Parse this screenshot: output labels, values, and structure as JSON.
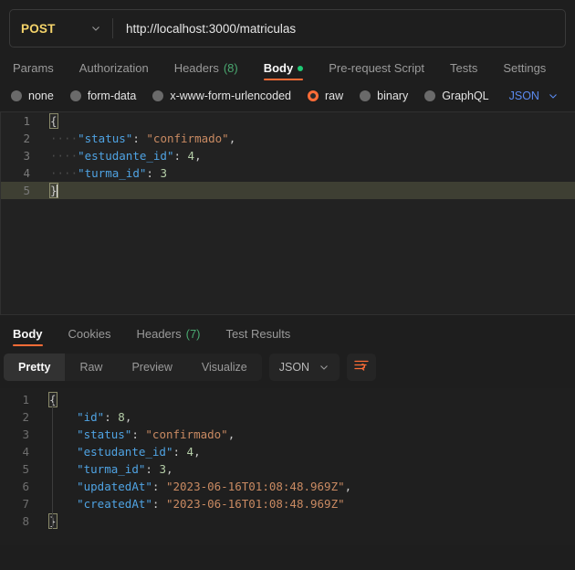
{
  "request": {
    "method": "POST",
    "method_caret_icon": "chevron-down-icon",
    "url": "http://localhost:3000/matriculas",
    "url_placeholder": "Enter request URL",
    "tabs": [
      {
        "label": "Params",
        "active": false
      },
      {
        "label": "Authorization",
        "active": false
      },
      {
        "label": "Headers",
        "count": "(8)",
        "active": false
      },
      {
        "label": "Body",
        "active": true,
        "dot": true
      },
      {
        "label": "Pre-request Script",
        "active": false
      },
      {
        "label": "Tests",
        "active": false
      },
      {
        "label": "Settings",
        "active": false
      }
    ],
    "body_types": [
      {
        "label": "none",
        "selected": false
      },
      {
        "label": "form-data",
        "selected": false
      },
      {
        "label": "x-www-form-urlencoded",
        "selected": false
      },
      {
        "label": "raw",
        "selected": true
      },
      {
        "label": "binary",
        "selected": false
      },
      {
        "label": "GraphQL",
        "selected": false
      }
    ],
    "language": "JSON",
    "language_caret_icon": "chevron-down-icon",
    "editor": {
      "line_numbers": [
        "1",
        "2",
        "3",
        "4",
        "5"
      ],
      "lines": [
        {
          "n": "1",
          "open_brace": "{"
        },
        {
          "n": "2",
          "indent": "····",
          "key": "\"status\"",
          "colon": ":",
          "value": "\"confirmado\"",
          "comma": ","
        },
        {
          "n": "3",
          "indent": "····",
          "key": "\"estudante_id\"",
          "colon": ":",
          "value": "4",
          "value_type": "number",
          "comma": ","
        },
        {
          "n": "4",
          "indent": "····",
          "key": "\"turma_id\"",
          "colon": ":",
          "value": "3",
          "value_type": "number",
          "comma": ""
        },
        {
          "n": "5",
          "close_brace": "}",
          "active": true
        }
      ]
    }
  },
  "response": {
    "tabs": [
      {
        "label": "Body",
        "active": true
      },
      {
        "label": "Cookies",
        "active": false
      },
      {
        "label": "Headers",
        "count": "(7)",
        "active": false
      },
      {
        "label": "Test Results",
        "active": false
      }
    ],
    "view_modes": [
      {
        "label": "Pretty",
        "active": true
      },
      {
        "label": "Raw",
        "active": false
      },
      {
        "label": "Preview",
        "active": false
      },
      {
        "label": "Visualize",
        "active": false
      }
    ],
    "language": "JSON",
    "language_caret_icon": "chevron-down-icon",
    "wrap_icon": "wrap-lines-icon",
    "body": {
      "line_numbers": [
        "1",
        "2",
        "3",
        "4",
        "5",
        "6",
        "7",
        "8"
      ],
      "lines": [
        {
          "n": "1",
          "open_brace": "{"
        },
        {
          "n": "2",
          "key": "\"id\"",
          "colon": ":",
          "value": "8",
          "value_type": "number",
          "comma": ","
        },
        {
          "n": "3",
          "key": "\"status\"",
          "colon": ":",
          "value": "\"confirmado\"",
          "comma": ","
        },
        {
          "n": "4",
          "key": "\"estudante_id\"",
          "colon": ":",
          "value": "4",
          "value_type": "number",
          "comma": ","
        },
        {
          "n": "5",
          "key": "\"turma_id\"",
          "colon": ":",
          "value": "3",
          "value_type": "number",
          "comma": ","
        },
        {
          "n": "6",
          "key": "\"updatedAt\"",
          "colon": ":",
          "value": "\"2023-06-16T01:08:48.969Z\"",
          "comma": ","
        },
        {
          "n": "7",
          "key": "\"createdAt\"",
          "colon": ":",
          "value": "\"2023-06-16T01:08:48.969Z\"",
          "comma": ""
        },
        {
          "n": "8",
          "close_brace": "}"
        }
      ]
    }
  },
  "colors": {
    "accent": "#ff6c37",
    "method": "#f5d46a",
    "count_green": "#4aa870",
    "dot_green": "#1ec974",
    "link_blue": "#5b8bf0",
    "json_key": "#4fa3e3",
    "json_string": "#c98a62",
    "json_number": "#b5cea8",
    "background": "#1e1e1e"
  }
}
